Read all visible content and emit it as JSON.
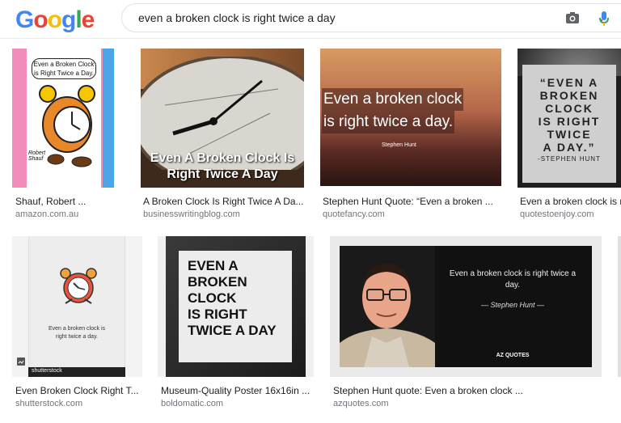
{
  "header": {
    "logo_letters": [
      "G",
      "o",
      "o",
      "g",
      "l",
      "e"
    ],
    "logo_colors": [
      "#4285f4",
      "#ea4335",
      "#fbbc05",
      "#4285f4",
      "#34a853",
      "#ea4335"
    ],
    "query": "even a broken clock is right twice a day"
  },
  "results": [
    {
      "title": "Shauf, Robert ...",
      "source": "amazon.com.au",
      "img_text_1": "Even a Broken Clock",
      "img_text_2": "is Right Twice a Day.",
      "img_sig": "Robert Shauf"
    },
    {
      "title": "A Broken Clock Is Right Twice A Da...",
      "source": "businesswritingblog.com",
      "img_text_1": "Even A Broken Clock Is",
      "img_text_2": "Right Twice A Day"
    },
    {
      "title": "Stephen Hunt Quote: “Even a broken ...",
      "source": "quotefancy.com",
      "img_text_1": "Even a broken clock",
      "img_text_2": "is right twice a day.",
      "img_sig": "Stephen Hunt"
    },
    {
      "title": "Even a broken clock is r",
      "source": "quotestoenjoy.com",
      "img_lines": [
        "“EVEN A",
        "BROKEN",
        "CLOCK",
        "IS RIGHT",
        "TWICE",
        "A DAY.”"
      ],
      "img_sig": "-STEPHEN HUNT"
    },
    {
      "title": "Even Broken Clock Right T...",
      "source": "shutterstock.com",
      "img_text_1": "Even a broken clock is",
      "img_text_2": "right twice a day.",
      "img_brand": "shutterstock"
    },
    {
      "title": "Museum-Quality Poster 16x16in ...",
      "source": "boldomatic.com",
      "img_lines": [
        "EVEN A",
        "BROKEN",
        "CLOCK",
        "IS RIGHT",
        "TWICE A DAY"
      ]
    },
    {
      "title": "Stephen Hunt quote: Even a broken clock ...",
      "source": "azquotes.com",
      "img_text_1": "Even a broken clock is right twice a",
      "img_text_2": "day.",
      "img_sig": "— Stephen Hunt —",
      "img_brand": "AZ QUOTES"
    }
  ]
}
